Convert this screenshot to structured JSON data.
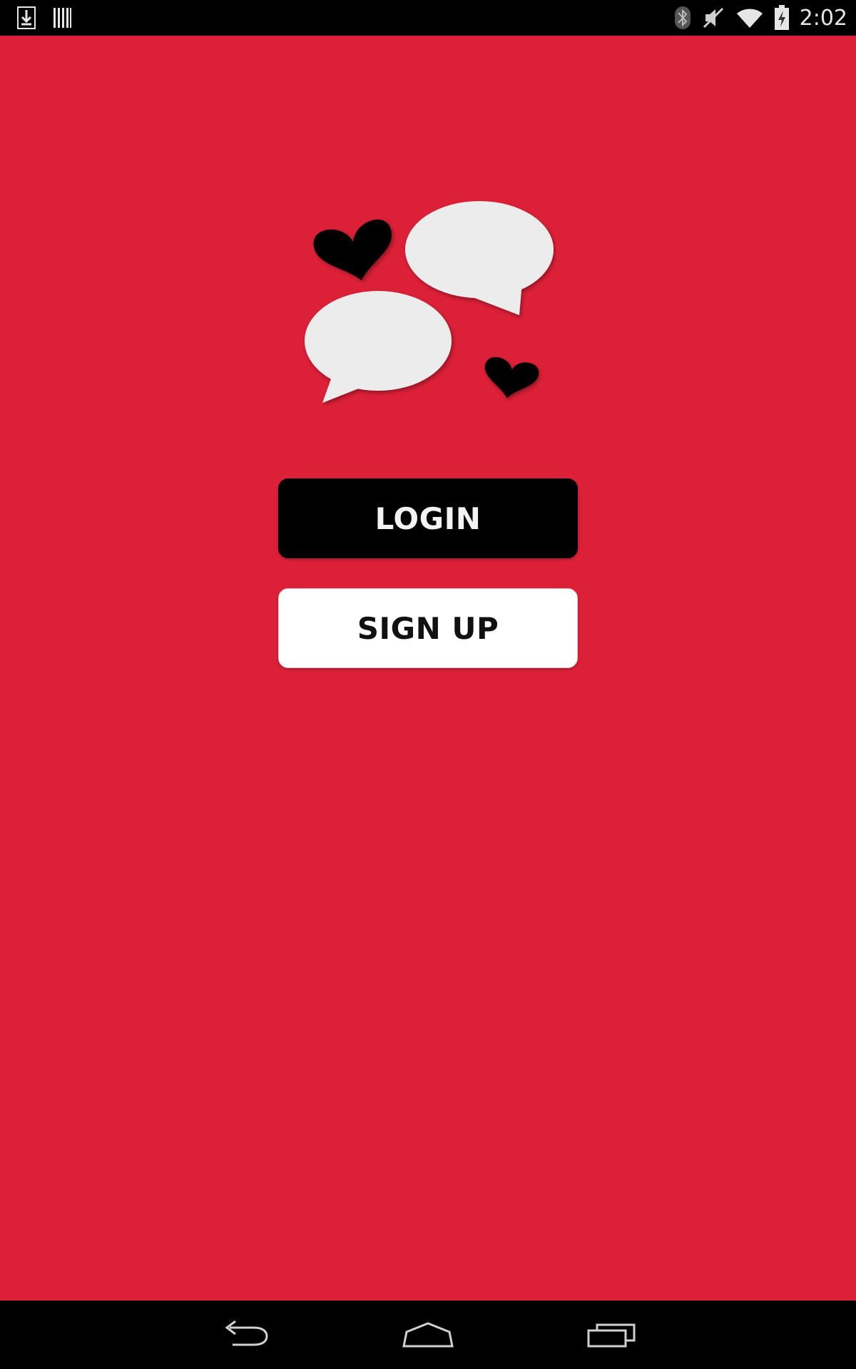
{
  "status_bar": {
    "time": "2:02",
    "left_icons": [
      "download-icon",
      "barcode-icon"
    ],
    "right_icons": [
      "bluetooth-icon",
      "mute-icon",
      "wifi-icon",
      "battery-charging-icon"
    ]
  },
  "main": {
    "background_color": "#dc2037",
    "logo": {
      "icons": [
        "heart-icon",
        "speech-bubble-icon",
        "speech-bubble-icon",
        "heart-icon"
      ]
    },
    "login_label": "LOGIN",
    "signup_label": "SIGN UP"
  },
  "nav_bar": {
    "icons": [
      "back-icon",
      "home-icon",
      "recents-icon"
    ]
  }
}
